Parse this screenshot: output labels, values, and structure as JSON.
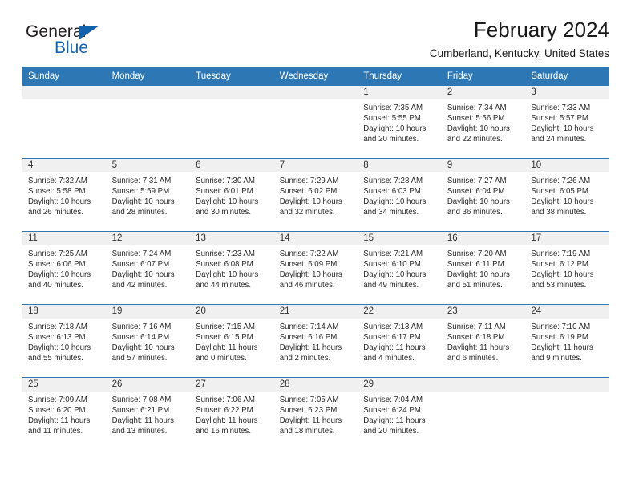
{
  "brand": {
    "name_part1": "General",
    "name_part2": "Blue",
    "logo_icon": "blue-triangle-logo",
    "color_dark": "#231f20",
    "color_blue": "#1263ad"
  },
  "header": {
    "title": "February 2024",
    "subtitle": "Cumberland, Kentucky, United States"
  },
  "theme": {
    "header_blue": "#2e77b5",
    "daynum_band": "#f0f0f0",
    "text": "#2b2b2b"
  },
  "weekday_headers": [
    "Sunday",
    "Monday",
    "Tuesday",
    "Wednesday",
    "Thursday",
    "Friday",
    "Saturday"
  ],
  "weeks": [
    [
      {
        "day": "",
        "sunrise": "",
        "sunset": "",
        "daylight_line1": "",
        "daylight_line2": ""
      },
      {
        "day": "",
        "sunrise": "",
        "sunset": "",
        "daylight_line1": "",
        "daylight_line2": ""
      },
      {
        "day": "",
        "sunrise": "",
        "sunset": "",
        "daylight_line1": "",
        "daylight_line2": ""
      },
      {
        "day": "",
        "sunrise": "",
        "sunset": "",
        "daylight_line1": "",
        "daylight_line2": ""
      },
      {
        "day": "1",
        "sunrise": "Sunrise: 7:35 AM",
        "sunset": "Sunset: 5:55 PM",
        "daylight_line1": "Daylight: 10 hours",
        "daylight_line2": "and 20 minutes."
      },
      {
        "day": "2",
        "sunrise": "Sunrise: 7:34 AM",
        "sunset": "Sunset: 5:56 PM",
        "daylight_line1": "Daylight: 10 hours",
        "daylight_line2": "and 22 minutes."
      },
      {
        "day": "3",
        "sunrise": "Sunrise: 7:33 AM",
        "sunset": "Sunset: 5:57 PM",
        "daylight_line1": "Daylight: 10 hours",
        "daylight_line2": "and 24 minutes."
      }
    ],
    [
      {
        "day": "4",
        "sunrise": "Sunrise: 7:32 AM",
        "sunset": "Sunset: 5:58 PM",
        "daylight_line1": "Daylight: 10 hours",
        "daylight_line2": "and 26 minutes."
      },
      {
        "day": "5",
        "sunrise": "Sunrise: 7:31 AM",
        "sunset": "Sunset: 5:59 PM",
        "daylight_line1": "Daylight: 10 hours",
        "daylight_line2": "and 28 minutes."
      },
      {
        "day": "6",
        "sunrise": "Sunrise: 7:30 AM",
        "sunset": "Sunset: 6:01 PM",
        "daylight_line1": "Daylight: 10 hours",
        "daylight_line2": "and 30 minutes."
      },
      {
        "day": "7",
        "sunrise": "Sunrise: 7:29 AM",
        "sunset": "Sunset: 6:02 PM",
        "daylight_line1": "Daylight: 10 hours",
        "daylight_line2": "and 32 minutes."
      },
      {
        "day": "8",
        "sunrise": "Sunrise: 7:28 AM",
        "sunset": "Sunset: 6:03 PM",
        "daylight_line1": "Daylight: 10 hours",
        "daylight_line2": "and 34 minutes."
      },
      {
        "day": "9",
        "sunrise": "Sunrise: 7:27 AM",
        "sunset": "Sunset: 6:04 PM",
        "daylight_line1": "Daylight: 10 hours",
        "daylight_line2": "and 36 minutes."
      },
      {
        "day": "10",
        "sunrise": "Sunrise: 7:26 AM",
        "sunset": "Sunset: 6:05 PM",
        "daylight_line1": "Daylight: 10 hours",
        "daylight_line2": "and 38 minutes."
      }
    ],
    [
      {
        "day": "11",
        "sunrise": "Sunrise: 7:25 AM",
        "sunset": "Sunset: 6:06 PM",
        "daylight_line1": "Daylight: 10 hours",
        "daylight_line2": "and 40 minutes."
      },
      {
        "day": "12",
        "sunrise": "Sunrise: 7:24 AM",
        "sunset": "Sunset: 6:07 PM",
        "daylight_line1": "Daylight: 10 hours",
        "daylight_line2": "and 42 minutes."
      },
      {
        "day": "13",
        "sunrise": "Sunrise: 7:23 AM",
        "sunset": "Sunset: 6:08 PM",
        "daylight_line1": "Daylight: 10 hours",
        "daylight_line2": "and 44 minutes."
      },
      {
        "day": "14",
        "sunrise": "Sunrise: 7:22 AM",
        "sunset": "Sunset: 6:09 PM",
        "daylight_line1": "Daylight: 10 hours",
        "daylight_line2": "and 46 minutes."
      },
      {
        "day": "15",
        "sunrise": "Sunrise: 7:21 AM",
        "sunset": "Sunset: 6:10 PM",
        "daylight_line1": "Daylight: 10 hours",
        "daylight_line2": "and 49 minutes."
      },
      {
        "day": "16",
        "sunrise": "Sunrise: 7:20 AM",
        "sunset": "Sunset: 6:11 PM",
        "daylight_line1": "Daylight: 10 hours",
        "daylight_line2": "and 51 minutes."
      },
      {
        "day": "17",
        "sunrise": "Sunrise: 7:19 AM",
        "sunset": "Sunset: 6:12 PM",
        "daylight_line1": "Daylight: 10 hours",
        "daylight_line2": "and 53 minutes."
      }
    ],
    [
      {
        "day": "18",
        "sunrise": "Sunrise: 7:18 AM",
        "sunset": "Sunset: 6:13 PM",
        "daylight_line1": "Daylight: 10 hours",
        "daylight_line2": "and 55 minutes."
      },
      {
        "day": "19",
        "sunrise": "Sunrise: 7:16 AM",
        "sunset": "Sunset: 6:14 PM",
        "daylight_line1": "Daylight: 10 hours",
        "daylight_line2": "and 57 minutes."
      },
      {
        "day": "20",
        "sunrise": "Sunrise: 7:15 AM",
        "sunset": "Sunset: 6:15 PM",
        "daylight_line1": "Daylight: 11 hours",
        "daylight_line2": "and 0 minutes."
      },
      {
        "day": "21",
        "sunrise": "Sunrise: 7:14 AM",
        "sunset": "Sunset: 6:16 PM",
        "daylight_line1": "Daylight: 11 hours",
        "daylight_line2": "and 2 minutes."
      },
      {
        "day": "22",
        "sunrise": "Sunrise: 7:13 AM",
        "sunset": "Sunset: 6:17 PM",
        "daylight_line1": "Daylight: 11 hours",
        "daylight_line2": "and 4 minutes."
      },
      {
        "day": "23",
        "sunrise": "Sunrise: 7:11 AM",
        "sunset": "Sunset: 6:18 PM",
        "daylight_line1": "Daylight: 11 hours",
        "daylight_line2": "and 6 minutes."
      },
      {
        "day": "24",
        "sunrise": "Sunrise: 7:10 AM",
        "sunset": "Sunset: 6:19 PM",
        "daylight_line1": "Daylight: 11 hours",
        "daylight_line2": "and 9 minutes."
      }
    ],
    [
      {
        "day": "25",
        "sunrise": "Sunrise: 7:09 AM",
        "sunset": "Sunset: 6:20 PM",
        "daylight_line1": "Daylight: 11 hours",
        "daylight_line2": "and 11 minutes."
      },
      {
        "day": "26",
        "sunrise": "Sunrise: 7:08 AM",
        "sunset": "Sunset: 6:21 PM",
        "daylight_line1": "Daylight: 11 hours",
        "daylight_line2": "and 13 minutes."
      },
      {
        "day": "27",
        "sunrise": "Sunrise: 7:06 AM",
        "sunset": "Sunset: 6:22 PM",
        "daylight_line1": "Daylight: 11 hours",
        "daylight_line2": "and 16 minutes."
      },
      {
        "day": "28",
        "sunrise": "Sunrise: 7:05 AM",
        "sunset": "Sunset: 6:23 PM",
        "daylight_line1": "Daylight: 11 hours",
        "daylight_line2": "and 18 minutes."
      },
      {
        "day": "29",
        "sunrise": "Sunrise: 7:04 AM",
        "sunset": "Sunset: 6:24 PM",
        "daylight_line1": "Daylight: 11 hours",
        "daylight_line2": "and 20 minutes."
      },
      {
        "day": "",
        "sunrise": "",
        "sunset": "",
        "daylight_line1": "",
        "daylight_line2": ""
      },
      {
        "day": "",
        "sunrise": "",
        "sunset": "",
        "daylight_line1": "",
        "daylight_line2": ""
      }
    ]
  ]
}
